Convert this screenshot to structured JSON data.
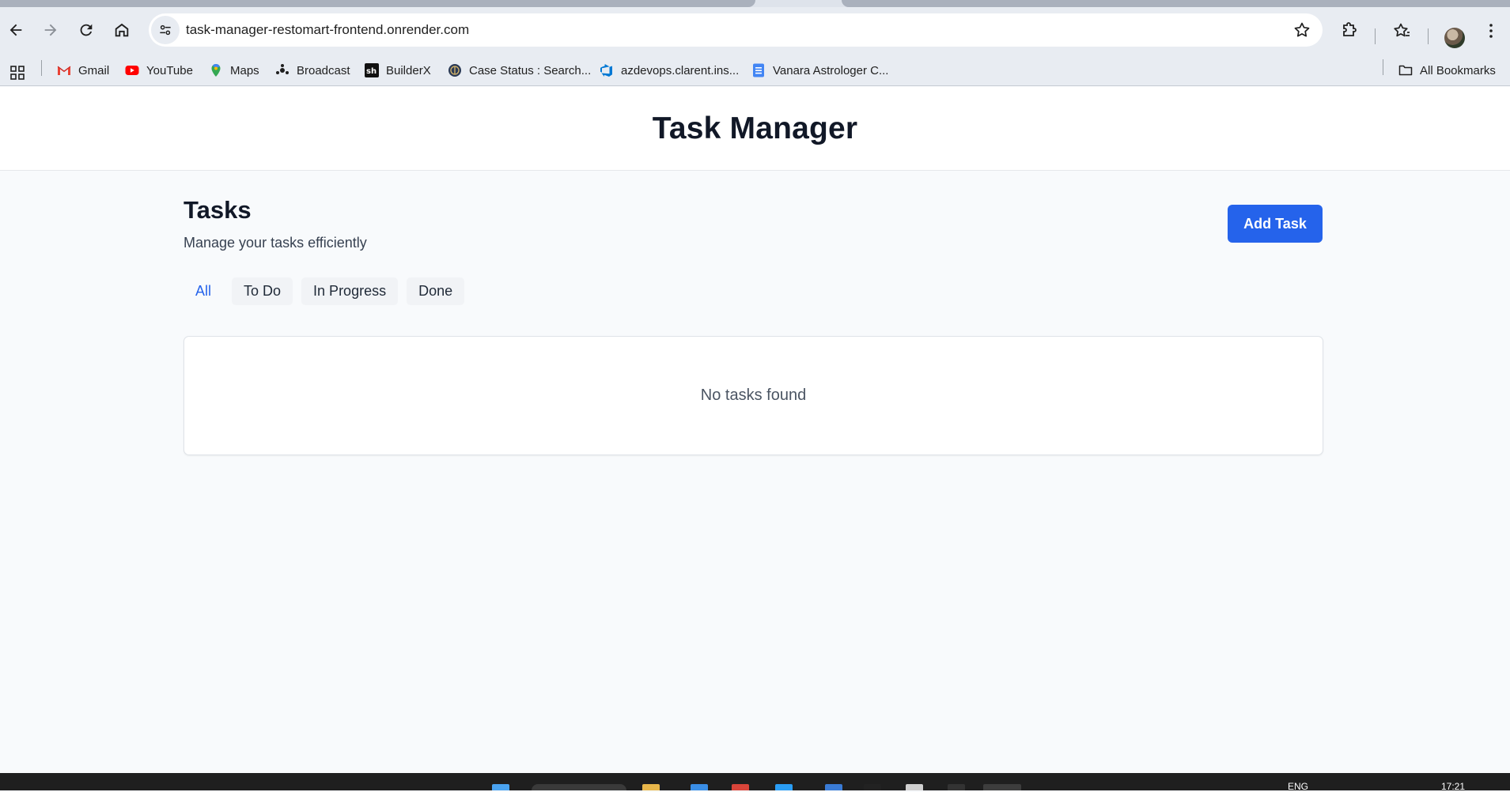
{
  "browser": {
    "url": "task-manager-restomart-frontend.onrender.com",
    "bookmarks": [
      {
        "label": "Gmail",
        "icon": "gmail-icon"
      },
      {
        "label": "YouTube",
        "icon": "youtube-icon"
      },
      {
        "label": "Maps",
        "icon": "maps-icon"
      },
      {
        "label": "Broadcast",
        "icon": "broadcast-icon"
      },
      {
        "label": "BuilderX",
        "icon": "builderx-icon"
      },
      {
        "label": "Case Status : Search...",
        "icon": "case-status-icon"
      },
      {
        "label": "azdevops.clarent.ins...",
        "icon": "azure-devops-icon"
      },
      {
        "label": "Vanara Astrologer C...",
        "icon": "docs-icon"
      }
    ],
    "all_bookmarks_label": "All Bookmarks"
  },
  "header": {
    "title": "Task Manager"
  },
  "tasks": {
    "title": "Tasks",
    "subtitle": "Manage your tasks efficiently",
    "add_button": "Add Task",
    "filters": [
      {
        "label": "All",
        "active": true
      },
      {
        "label": "To Do",
        "active": false
      },
      {
        "label": "In Progress",
        "active": false
      },
      {
        "label": "Done",
        "active": false
      }
    ],
    "empty_message": "No tasks found"
  },
  "taskbar": {
    "lang": "ENG",
    "time": "17:21"
  },
  "colors": {
    "accent": "#2563eb",
    "page_bg": "#f8fafc"
  }
}
